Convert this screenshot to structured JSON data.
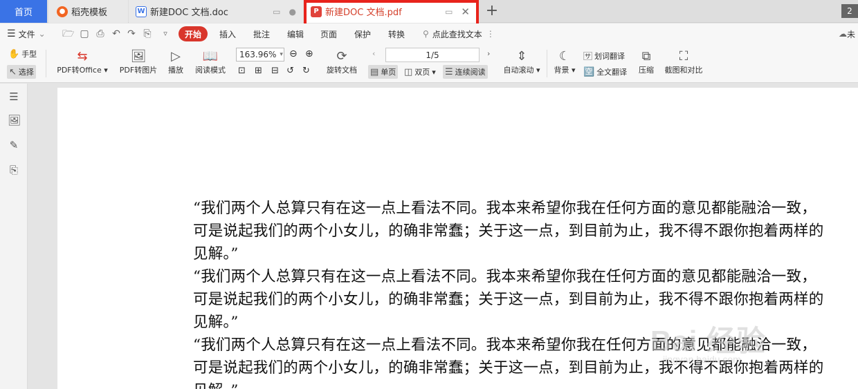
{
  "tabs": {
    "home": "首页",
    "templates": "稻壳模板",
    "doc": "新建DOC 文档.doc",
    "pdf": "新建DOC 文档.pdf",
    "new_tab": "+",
    "window_count": "2"
  },
  "menu": {
    "file": "文件",
    "start": "开始",
    "insert": "插入",
    "annotate": "批注",
    "edit": "编辑",
    "page": "页面",
    "protect": "保护",
    "convert": "转换",
    "search": "点此查找文本",
    "right_label": "未"
  },
  "ribbon": {
    "hand": "手型",
    "select": "选择",
    "pdf_to_office": "PDF转Office",
    "pdf_to_image": "PDF转图片",
    "play": "播放",
    "read_mode": "阅读模式",
    "zoom": "163.96%",
    "rotate": "旋转文档",
    "page_indicator": "1/5",
    "single_page": "单页",
    "double_page": "双页",
    "continuous": "连续阅读",
    "auto_scroll": "自动滚动",
    "background": "背景",
    "word_translate": "划词翻译",
    "full_translate": "全文翻译",
    "compress": "压缩",
    "screenshot_compare": "截图和对比"
  },
  "document": {
    "paragraphs": [
      "“我们两个人总算只有在这一点上看法不同。我本来希望你我在任何方面的意见都能融洽一致，可是说起我们的两个小女儿，的确非常蠢；关于这一点，到目前为止，我不得不跟你抱着两样的见解。”",
      "“我们两个人总算只有在这一点上看法不同。我本来希望你我在任何方面的意见都能融洽一致，可是说起我们的两个小女儿，的确非常蠢；关于这一点，到目前为止，我不得不跟你抱着两样的见解。”",
      "“我们两个人总算只有在这一点上看法不同。我本来希望你我在任何方面的意见都能融洽一致，可是说起我们的两个小女儿，的确非常蠢；关于这一点，到目前为止，我不得不跟你抱着两样的见解。”"
    ]
  },
  "watermark": {
    "main": "Bai 经验",
    "sub": "jingyan.baidu.com"
  },
  "colors": {
    "accent_blue": "#3a73e6",
    "highlight_red": "#e8231c",
    "start_red": "#d9362b"
  }
}
